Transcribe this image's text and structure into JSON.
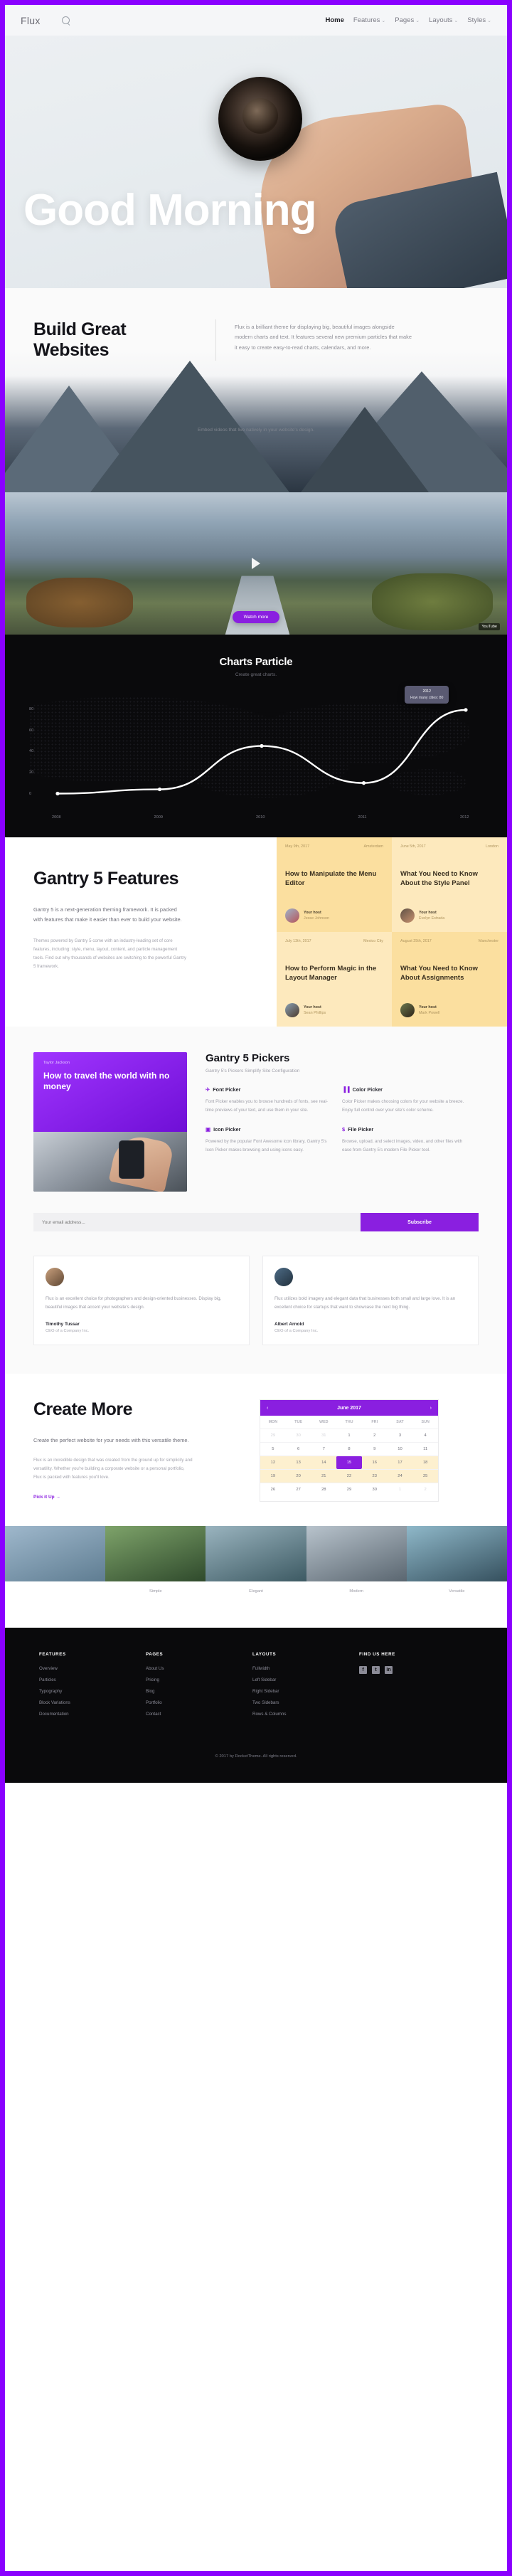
{
  "header": {
    "logo": "Flux",
    "search_placeholder": "",
    "nav": [
      {
        "label": "Home",
        "active": true,
        "caret": false
      },
      {
        "label": "Features",
        "active": false,
        "caret": true
      },
      {
        "label": "Pages",
        "active": false,
        "caret": true
      },
      {
        "label": "Layouts",
        "active": false,
        "caret": true
      },
      {
        "label": "Styles",
        "active": false,
        "caret": true
      }
    ]
  },
  "hero": {
    "title": "Good Morning",
    "tiles": [
      {
        "name": "search-tile",
        "glyph": "⌕"
      },
      {
        "name": "food-tile",
        "glyph": "🍽"
      },
      {
        "name": "photo-tile",
        "glyph": ""
      }
    ]
  },
  "build": {
    "heading": "Build Great Websites",
    "paragraph": "Flux is a brilliant theme for displaying big, beautiful images alongside modern charts and text. It features several new premium particles that make it easy to create easy-to-read charts, calendars, and more.",
    "embed_caption": "Embed videos that live natively in your website's design."
  },
  "video": {
    "watch_label": "Watch more",
    "badge": "YouTube"
  },
  "charts": {
    "heading": "Charts Particle",
    "subheading": "Create great charts."
  },
  "chart_data": {
    "type": "line",
    "title": "Charts Particle",
    "subtitle": "Create great charts.",
    "xlabel": "",
    "ylabel": "",
    "x": [
      "2008",
      "2009",
      "2010",
      "2011",
      "2012"
    ],
    "categories": [
      "2008",
      "2009",
      "2010",
      "2011",
      "2012"
    ],
    "values": [
      1,
      5,
      46,
      11,
      80
    ],
    "series": [
      {
        "name": "How many cities",
        "values": [
          1,
          5,
          46,
          11,
          80
        ]
      }
    ],
    "yticks": [
      0,
      20,
      40,
      60,
      80
    ],
    "ylim": [
      0,
      88
    ],
    "grid": false,
    "legend": "none",
    "line_color": "#ffffff",
    "background": "#0a0a0c",
    "annotation": {
      "x": "2012",
      "label": "2012",
      "value_text": "How many cities: 80"
    }
  },
  "gantry": {
    "heading": "Gantry 5 Features",
    "paragraph1": "Gantry 5 is a next-generation theming framework. It is packed with features that make it easier than ever to build your website.",
    "paragraph2": "Themes powered by Gantry 5 come with an industry-leading set of core features, including: style, menu, layout, content, and particle management tools. Find out why thousands of websites are switching to the powerful Gantry 5 framework.",
    "cards": [
      {
        "date": "May 9th, 2017",
        "city": "Amsterdam",
        "title": "How to Manipulate the Menu Editor",
        "host_label": "Your host",
        "host_name": "Jesse Johnson"
      },
      {
        "date": "June 5th, 2017",
        "city": "London",
        "title": "What You Need to Know About the Style Panel",
        "host_label": "Your host",
        "host_name": "Evelyn Estrada"
      },
      {
        "date": "July 13th, 2017",
        "city": "Mexico City",
        "title": "How to Perform Magic in the Layout Manager",
        "host_label": "Your host",
        "host_name": "Sean Phillips"
      },
      {
        "date": "August 25th, 2017",
        "city": "Manchester",
        "title": "What You Need to Know About Assignments",
        "host_label": "Your host",
        "host_name": "Mark Powell"
      }
    ]
  },
  "pickers": {
    "promo_kicker": "Taylor Jackson",
    "promo_title": "How to travel the world with no money",
    "heading": "Gantry 5 Pickers",
    "subheading": "Gantry 5's Pickers Simplify Site Configuration",
    "items": [
      {
        "icon": "✈",
        "icon_name": "plane-icon",
        "title": "Font Picker",
        "text": "Font Picker enables you to browse hundreds of fonts, see real-time previews of your text, and use them in your site."
      },
      {
        "icon": "▐▐",
        "icon_name": "palette-icon",
        "title": "Color Picker",
        "text": "Color Picker makes choosing colors for your website a breeze. Enjoy full control over your site's color scheme."
      },
      {
        "icon": "▣",
        "icon_name": "image-icon",
        "title": "Icon Picker",
        "text": "Powered by the popular Font Awesome icon library, Gantry 5's Icon Picker makes browsing and using icons easy."
      },
      {
        "icon": "$",
        "icon_name": "file-icon",
        "title": "File Picker",
        "text": "Browse, upload, and select images, video, and other files with ease from Gantry 5's modern File Picker tool."
      }
    ]
  },
  "subscribe": {
    "placeholder": "Your email address...",
    "button": "Subscribe"
  },
  "testimonials": [
    {
      "text": "Flux is an excellent choice for photographers and design-oriented businesses. Display big, beautiful images that accent your website's design.",
      "name": "Timothy Tussar",
      "role": "CEO of a Company Inc."
    },
    {
      "text": "Flux utilizes bold imagery and elegant data that businesses both small and large love. It is an excellent choice for startups that want to showcase the next big thing.",
      "name": "Albert Arnold",
      "role": "CEO of a Company Inc."
    }
  ],
  "create_more": {
    "heading": "Create More",
    "paragraph1": "Create the perfect website for your needs with this versatile theme.",
    "paragraph2": "Flux is an incredible design that was created from the ground up for simplicity and versatility. Whether you're building a corporate website or a personal portfolio, Flux is packed with features you'll love.",
    "link": "Pick it Up →"
  },
  "calendar": {
    "title": "June 2017",
    "prev": "‹",
    "next": "›",
    "dows": [
      "MON",
      "TUE",
      "WED",
      "THU",
      "FRI",
      "SAT",
      "SUN"
    ],
    "weeks": [
      [
        {
          "d": "29",
          "s": "mut"
        },
        {
          "d": "30",
          "s": "mut"
        },
        {
          "d": "31",
          "s": "mut"
        },
        {
          "d": "1",
          "s": ""
        },
        {
          "d": "2",
          "s": ""
        },
        {
          "d": "3",
          "s": ""
        },
        {
          "d": "4",
          "s": ""
        }
      ],
      [
        {
          "d": "5",
          "s": ""
        },
        {
          "d": "6",
          "s": ""
        },
        {
          "d": "7",
          "s": ""
        },
        {
          "d": "8",
          "s": ""
        },
        {
          "d": "9",
          "s": ""
        },
        {
          "d": "10",
          "s": ""
        },
        {
          "d": "11",
          "s": ""
        }
      ],
      [
        {
          "d": "12",
          "s": "hl"
        },
        {
          "d": "13",
          "s": "hl"
        },
        {
          "d": "14",
          "s": "hl"
        },
        {
          "d": "15",
          "s": "sel"
        },
        {
          "d": "16",
          "s": "hl"
        },
        {
          "d": "17",
          "s": "hl"
        },
        {
          "d": "18",
          "s": "hl"
        }
      ],
      [
        {
          "d": "19",
          "s": "hl"
        },
        {
          "d": "20",
          "s": "hl"
        },
        {
          "d": "21",
          "s": "hl"
        },
        {
          "d": "22",
          "s": "hl"
        },
        {
          "d": "23",
          "s": "hl"
        },
        {
          "d": "24",
          "s": "hl"
        },
        {
          "d": "25",
          "s": "hl"
        }
      ],
      [
        {
          "d": "26",
          "s": ""
        },
        {
          "d": "27",
          "s": ""
        },
        {
          "d": "28",
          "s": ""
        },
        {
          "d": "29",
          "s": ""
        },
        {
          "d": "30",
          "s": ""
        },
        {
          "d": "1",
          "s": "mut"
        },
        {
          "d": "2",
          "s": "mut"
        }
      ]
    ]
  },
  "gallery": [
    {
      "caption": ""
    },
    {
      "caption": "Simple"
    },
    {
      "caption": "Elegant"
    },
    {
      "caption": "Modern"
    },
    {
      "caption": "Versatile"
    }
  ],
  "footer": {
    "columns": [
      {
        "heading": "FEATURES",
        "links": [
          "Overview",
          "Particles",
          "Typography",
          "Block Variations",
          "Documentation"
        ]
      },
      {
        "heading": "PAGES",
        "links": [
          "About Us",
          "Pricing",
          "Blog",
          "Portfolio",
          "Contact"
        ]
      },
      {
        "heading": "LAYOUTS",
        "links": [
          "Fullwidth",
          "Left Sidebar",
          "Right Sidebar",
          "Two Sidebars",
          "Rows & Columns"
        ]
      }
    ],
    "social_heading": "FIND US HERE",
    "socials": [
      {
        "name": "facebook-icon",
        "glyph": "f"
      },
      {
        "name": "twitter-icon",
        "glyph": "t"
      },
      {
        "name": "linkedin-icon",
        "glyph": "in"
      }
    ],
    "copyright": "© 2017 by RocketTheme. All rights reserved."
  }
}
